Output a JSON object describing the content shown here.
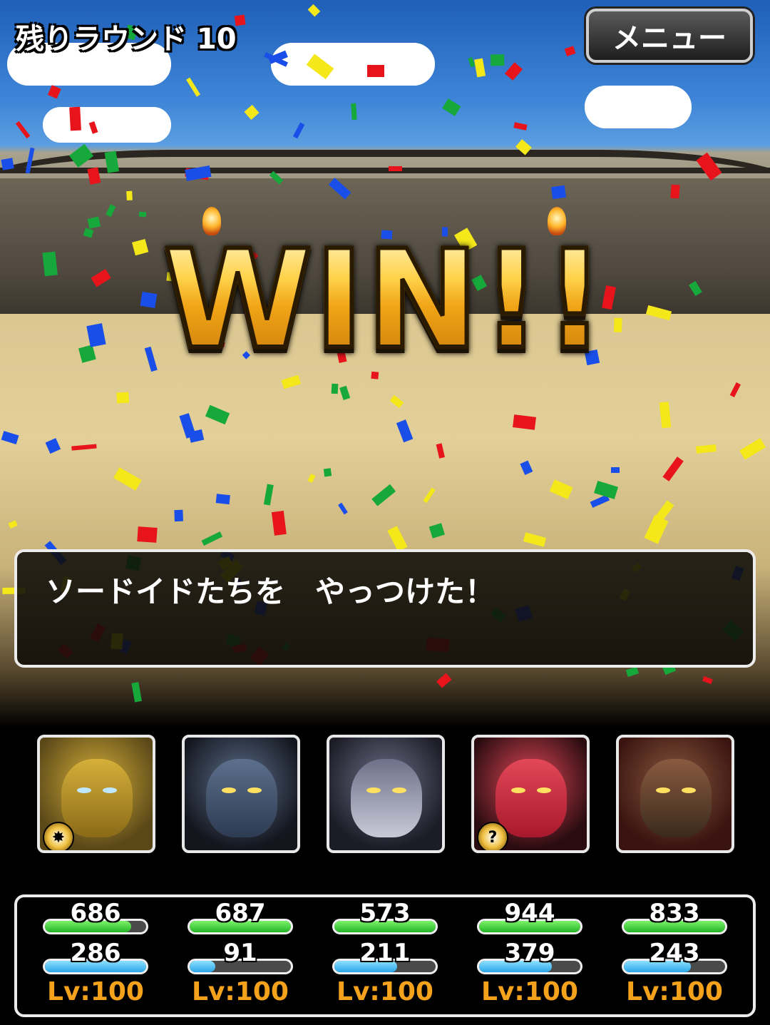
{
  "header": {
    "round_text": "残りラウンド 10",
    "menu_label": "メニュー"
  },
  "banner": {
    "text": "WIN!!"
  },
  "message": {
    "text": "ソードイドたちを　やっつけた！"
  },
  "party": [
    {
      "name_icon": "golem-portrait-icon",
      "hp": "686",
      "mp": "286",
      "hp_fraction": 0.85,
      "mp_fraction": 1.0,
      "level": "Lv:100",
      "badge": "sparkle-badge-icon"
    },
    {
      "name_icon": "vampire-portrait-icon",
      "hp": "687",
      "mp": "91",
      "hp_fraction": 1.0,
      "mp_fraction": 0.25,
      "level": "Lv:100",
      "badge": ""
    },
    {
      "name_icon": "dragon-portrait-icon",
      "hp": "573",
      "mp": "211",
      "hp_fraction": 1.0,
      "mp_fraction": 0.62,
      "level": "Lv:100",
      "badge": ""
    },
    {
      "name_icon": "demon-portrait-icon",
      "hp": "944",
      "mp": "379",
      "hp_fraction": 1.0,
      "mp_fraction": 0.72,
      "level": "Lv:100",
      "badge": "key-badge-icon"
    },
    {
      "name_icon": "warrior-portrait-icon",
      "hp": "833",
      "mp": "243",
      "hp_fraction": 1.0,
      "mp_fraction": 0.66,
      "level": "Lv:100",
      "badge": ""
    }
  ],
  "colors": {
    "hp": "#25b426",
    "mp": "#2aa6e8",
    "level": "#f4a21c",
    "confetti": [
      "#e8141c",
      "#1a4ee8",
      "#16a83a",
      "#f4e81a"
    ]
  }
}
